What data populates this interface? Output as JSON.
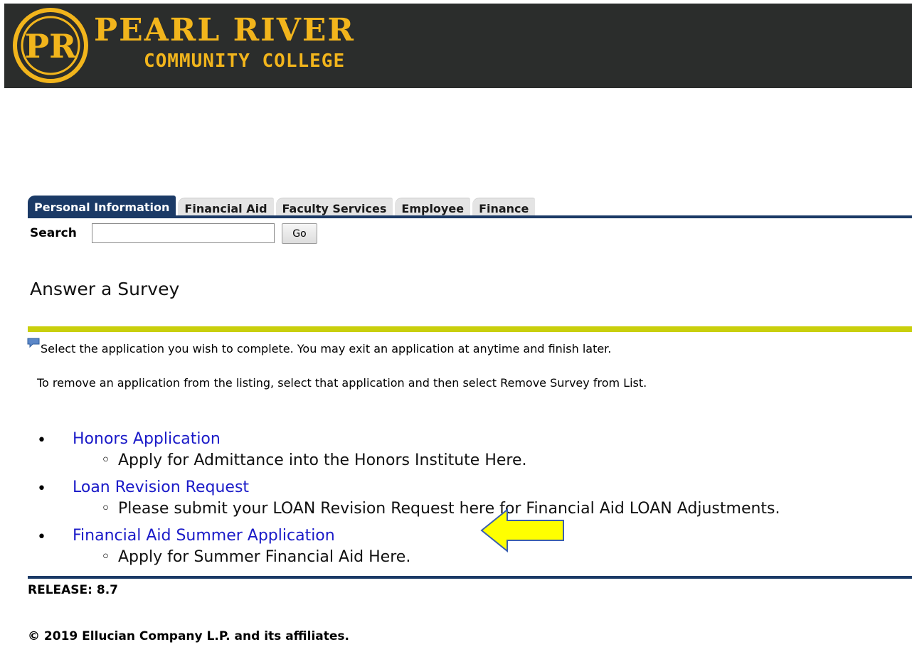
{
  "header": {
    "name": "PEARL RIVER",
    "subtitle": "COMMUNITY COLLEGE",
    "accent_color": "#f2b51c",
    "background_color": "#2b2d2c"
  },
  "tabs": [
    {
      "label": "Personal Information",
      "active": true
    },
    {
      "label": "Financial Aid",
      "active": false
    },
    {
      "label": "Faculty Services",
      "active": false
    },
    {
      "label": "Employee",
      "active": false
    },
    {
      "label": "Finance",
      "active": false
    }
  ],
  "search": {
    "label": "Search",
    "value": "",
    "button_label": "Go"
  },
  "page": {
    "title": "Answer a Survey",
    "info_icon": "speech-bubble-icon",
    "info_text": "Select the application you wish to complete. You may exit an application at anytime and finish later.",
    "instruction_text": "To remove an application from the listing, select that application and then select Remove Survey from List."
  },
  "surveys": [
    {
      "title": "Honors Application",
      "description": "Apply for Admittance into the Honors Institute Here."
    },
    {
      "title": "Loan Revision Request",
      "description": "Please submit your LOAN Revision Request here for Financial Aid LOAN Adjustments."
    },
    {
      "title": "Financial Aid Summer Application",
      "description": "Apply for Summer Financial Aid Here."
    }
  ],
  "annotation": {
    "icon": "yellow-arrow-icon",
    "color": "#ffff00"
  },
  "footer": {
    "release": "RELEASE: 8.7",
    "copyright": "© 2019 Ellucian Company L.P. and its affiliates."
  }
}
